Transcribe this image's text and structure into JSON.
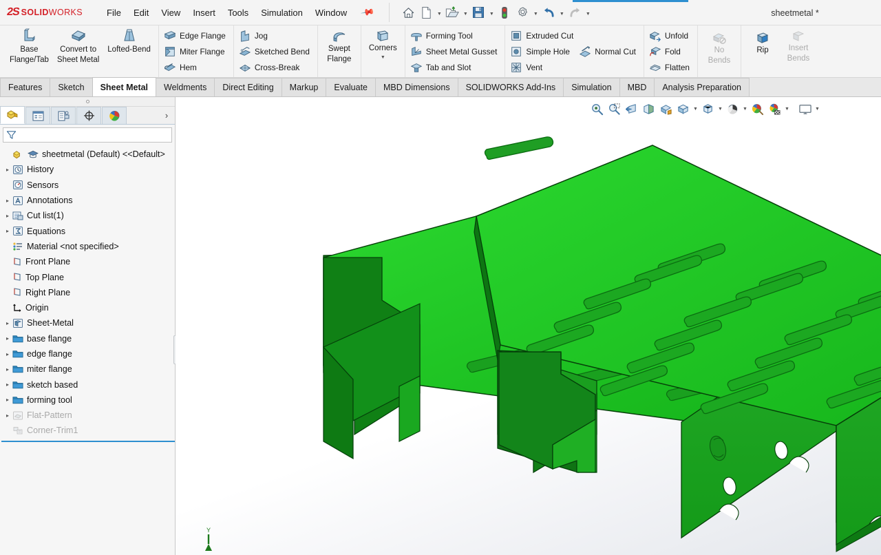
{
  "app": {
    "brand_ds": "2S",
    "brand_solid": "SOLID",
    "brand_works": "WORKS",
    "document_title": "sheetmetal *",
    "accent_color": "#2e8fd0",
    "brand_color": "#d42027",
    "model_color_top": "#22c426",
    "model_color_side": "#1f9e24",
    "model_color_dark": "#0f6b18"
  },
  "menu": {
    "items": [
      {
        "label": "File"
      },
      {
        "label": "Edit"
      },
      {
        "label": "View"
      },
      {
        "label": "Insert"
      },
      {
        "label": "Tools"
      },
      {
        "label": "Simulation"
      },
      {
        "label": "Window"
      }
    ],
    "pin_icon": "pushpin-icon"
  },
  "quick_access": {
    "buttons": [
      {
        "name": "home-button",
        "icon": "home-icon",
        "caret": false
      },
      {
        "name": "new-document-button",
        "icon": "new-file-icon",
        "caret": true
      },
      {
        "name": "open-document-button",
        "icon": "open-folder-icon",
        "caret": true
      },
      {
        "name": "save-button",
        "icon": "floppy-save-icon",
        "caret": true
      },
      {
        "name": "rebuild-button",
        "icon": "traffic-light-icon",
        "caret": false
      },
      {
        "name": "options-button",
        "icon": "gear-icon",
        "caret": true
      },
      {
        "name": "undo-button",
        "icon": "undo-arrow-icon",
        "caret": true
      },
      {
        "name": "redo-button",
        "icon": "redo-arrow-icon",
        "caret": true
      }
    ]
  },
  "ribbon": {
    "groups": [
      {
        "name": "base-group",
        "type": "big",
        "buttons": [
          {
            "label": "Base\nFlange/Tab",
            "line1": "Base",
            "line2": "Flange/Tab",
            "icon": "base-flange-icon",
            "disabled": false
          },
          {
            "label": "Convert to\nSheet Metal",
            "line1": "Convert to",
            "line2": "Sheet Metal",
            "icon": "convert-sheetmetal-icon",
            "disabled": false
          },
          {
            "label": "Lofted-Bend",
            "line1": "Lofted-Bend",
            "line2": "",
            "icon": "lofted-bend-icon",
            "disabled": false
          }
        ]
      },
      {
        "name": "flange-group",
        "type": "small",
        "buttons": [
          {
            "label": "Edge Flange",
            "icon": "edge-flange-icon"
          },
          {
            "label": "Miter Flange",
            "icon": "miter-flange-icon"
          },
          {
            "label": "Hem",
            "icon": "hem-icon"
          }
        ]
      },
      {
        "name": "bend-group",
        "type": "small",
        "buttons": [
          {
            "label": "Jog",
            "icon": "jog-icon"
          },
          {
            "label": "Sketched Bend",
            "icon": "sketched-bend-icon"
          },
          {
            "label": "Cross-Break",
            "icon": "cross-break-icon"
          }
        ]
      },
      {
        "name": "swept-flange-group",
        "type": "big",
        "buttons": [
          {
            "label": "Swept Flange",
            "line1": "Swept",
            "line2": "Flange",
            "icon": "swept-flange-icon",
            "disabled": false
          }
        ]
      },
      {
        "name": "corners-group",
        "type": "big",
        "buttons": [
          {
            "label": "Corners",
            "line1": "Corners",
            "line2": "",
            "icon": "corners-icon",
            "disabled": false,
            "caret": true
          }
        ]
      },
      {
        "name": "forming-group",
        "type": "small",
        "buttons": [
          {
            "label": "Forming Tool",
            "icon": "forming-tool-icon"
          },
          {
            "label": "Sheet Metal Gusset",
            "icon": "sheet-metal-gusset-icon"
          },
          {
            "label": "Tab and Slot",
            "icon": "tab-and-slot-icon"
          }
        ]
      },
      {
        "name": "cut-group",
        "type": "small-two-col",
        "col1": [
          {
            "label": "Extruded Cut",
            "icon": "extruded-cut-icon"
          },
          {
            "label": "Simple Hole",
            "icon": "simple-hole-icon"
          },
          {
            "label": "Vent",
            "icon": "vent-icon"
          }
        ],
        "col2": [
          {
            "label": "Normal Cut",
            "icon": "normal-cut-icon"
          }
        ]
      },
      {
        "name": "fold-group",
        "type": "small",
        "buttons": [
          {
            "label": "Unfold",
            "icon": "unfold-icon"
          },
          {
            "label": "Fold",
            "icon": "fold-icon"
          },
          {
            "label": "Flatten",
            "icon": "flatten-icon"
          }
        ]
      },
      {
        "name": "nobends-group",
        "type": "big",
        "buttons": [
          {
            "label": "No Bends",
            "line1": "No",
            "line2": "Bends",
            "icon": "no-bends-icon",
            "disabled": true
          }
        ]
      },
      {
        "name": "rip-group",
        "type": "big",
        "buttons": [
          {
            "label": "Rip",
            "line1": "Rip",
            "line2": "",
            "icon": "rip-icon",
            "disabled": false
          },
          {
            "label": "Insert Bends",
            "line1": "Insert",
            "line2": "Bends",
            "icon": "insert-bends-icon",
            "disabled": true
          }
        ]
      }
    ]
  },
  "command_tabs": {
    "active": "Sheet Metal",
    "items": [
      {
        "label": "Features"
      },
      {
        "label": "Sketch"
      },
      {
        "label": "Sheet Metal"
      },
      {
        "label": "Weldments"
      },
      {
        "label": "Direct Editing"
      },
      {
        "label": "Markup"
      },
      {
        "label": "Evaluate"
      },
      {
        "label": "MBD Dimensions"
      },
      {
        "label": "SOLIDWORKS Add-Ins"
      },
      {
        "label": "Simulation"
      },
      {
        "label": "MBD"
      },
      {
        "label": "Analysis Preparation"
      }
    ]
  },
  "left_panel": {
    "tabs": [
      {
        "name": "feature-manager-tab",
        "icon": "feature-tree-icon",
        "active": true
      },
      {
        "name": "property-manager-tab",
        "icon": "property-list-icon",
        "active": false
      },
      {
        "name": "configuration-manager-tab",
        "icon": "configuration-icon",
        "active": false
      },
      {
        "name": "dimxpert-manager-tab",
        "icon": "dimxpert-target-icon",
        "active": false
      },
      {
        "name": "appearances-tab",
        "icon": "appearances-sphere-icon",
        "active": false
      }
    ],
    "more_icon": "chevron-right-icon",
    "filter": {
      "icon": "filter-funnel-icon",
      "value": "",
      "placeholder": ""
    },
    "tree": [
      {
        "label": "sheetmetal (Default) <<Default>",
        "icon": "part-document-icon",
        "indent": 0,
        "expandable": false,
        "dim": false,
        "root": true
      },
      {
        "label": "History",
        "icon": "history-icon",
        "indent": 1,
        "expandable": true,
        "dim": false
      },
      {
        "label": "Sensors",
        "icon": "sensors-icon",
        "indent": 1,
        "expandable": false,
        "dim": false
      },
      {
        "label": "Annotations",
        "icon": "annotations-icon",
        "indent": 1,
        "expandable": true,
        "dim": false
      },
      {
        "label": "Cut list(1)",
        "icon": "cut-list-icon",
        "indent": 1,
        "expandable": true,
        "dim": false
      },
      {
        "label": "Equations",
        "icon": "equations-icon",
        "indent": 1,
        "expandable": true,
        "dim": false
      },
      {
        "label": "Material <not specified>",
        "icon": "material-icon",
        "indent": 1,
        "expandable": false,
        "dim": false
      },
      {
        "label": "Front Plane",
        "icon": "plane-icon",
        "indent": 1,
        "expandable": false,
        "dim": false
      },
      {
        "label": "Top Plane",
        "icon": "plane-icon",
        "indent": 1,
        "expandable": false,
        "dim": false
      },
      {
        "label": "Right Plane",
        "icon": "plane-icon",
        "indent": 1,
        "expandable": false,
        "dim": false
      },
      {
        "label": "Origin",
        "icon": "origin-icon",
        "indent": 1,
        "expandable": false,
        "dim": false
      },
      {
        "label": "Sheet-Metal",
        "icon": "sheet-metal-feature-icon",
        "indent": 1,
        "expandable": true,
        "dim": false
      },
      {
        "label": "base flange",
        "icon": "folder-icon",
        "indent": 1,
        "expandable": true,
        "dim": false
      },
      {
        "label": "edge flange",
        "icon": "folder-icon",
        "indent": 1,
        "expandable": true,
        "dim": false
      },
      {
        "label": "miter flange",
        "icon": "folder-icon",
        "indent": 1,
        "expandable": true,
        "dim": false
      },
      {
        "label": "sketch based",
        "icon": "folder-icon",
        "indent": 1,
        "expandable": true,
        "dim": false
      },
      {
        "label": "forming tool",
        "icon": "folder-icon",
        "indent": 1,
        "expandable": true,
        "dim": false
      },
      {
        "label": "Flat-Pattern",
        "icon": "flat-pattern-icon",
        "indent": 1,
        "expandable": true,
        "dim": true
      },
      {
        "label": "Corner-Trim1",
        "icon": "corner-trim-icon",
        "indent": 1,
        "expandable": false,
        "dim": true
      }
    ]
  },
  "view_toolbar": {
    "buttons": [
      {
        "name": "zoom-to-fit-button",
        "icon": "zoom-fit-icon",
        "caret": false
      },
      {
        "name": "zoom-to-area-button",
        "icon": "zoom-area-icon",
        "caret": false
      },
      {
        "name": "previous-view-button",
        "icon": "previous-view-icon",
        "caret": false
      },
      {
        "name": "section-view-button",
        "icon": "section-view-icon",
        "caret": false
      },
      {
        "name": "view-orientation-button",
        "icon": "view-orientation-icon",
        "caret": false
      },
      {
        "name": "display-style-button",
        "icon": "display-style-icon",
        "caret": true
      },
      {
        "name": "hide-show-items-button",
        "icon": "hide-show-cube-icon",
        "caret": true
      },
      {
        "name": "edit-appearance-button",
        "icon": "appearance-sphere-icon",
        "caret": true
      },
      {
        "name": "apply-scene-button",
        "icon": "scene-icon",
        "caret": false
      },
      {
        "name": "view-settings-button",
        "icon": "view-settings-icon",
        "caret": true
      },
      {
        "name": "display-monitor-button",
        "icon": "monitor-icon",
        "caret": true
      }
    ]
  },
  "graphics": {
    "triad": {
      "axis_label": "Y",
      "color": "#1d7a1d"
    },
    "model_name": "sheetmetal-part-3d-model"
  }
}
